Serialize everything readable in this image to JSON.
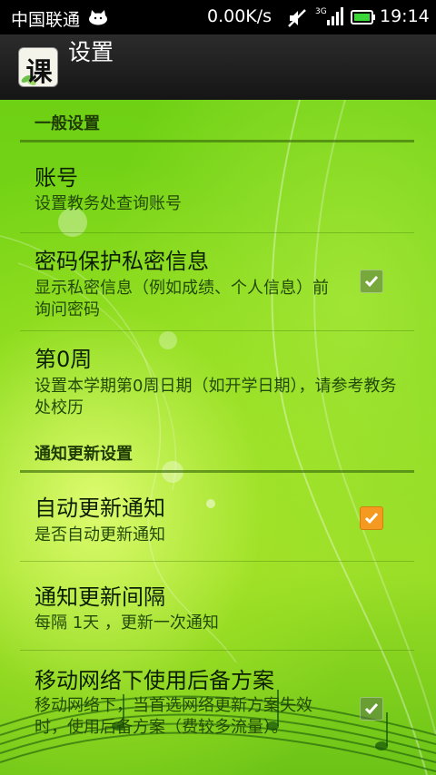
{
  "status_bar": {
    "carrier": "中国联通",
    "speed": "0.00K/s",
    "network_type": "3G",
    "time": "19:14",
    "icons": [
      "cat-icon",
      "mute-icon",
      "signal-icon",
      "battery-icon"
    ]
  },
  "action_bar": {
    "app_icon_char": "课",
    "title": "设置"
  },
  "sections": {
    "general": {
      "title": "一般设置",
      "items": [
        {
          "title": "账号",
          "summary": "设置教务处查询账号"
        },
        {
          "title": "密码保护私密信息",
          "summary": "显示私密信息（例如成绩、个人信息）前询问密码",
          "checked": false
        },
        {
          "title": "第0周",
          "summary": "设置本学期第0周日期（如开学日期），请参考教务处校历"
        }
      ]
    },
    "notify": {
      "title": "通知更新设置",
      "items": [
        {
          "title": "自动更新通知",
          "summary": "是否自动更新通知",
          "checked": true
        },
        {
          "title": "通知更新间隔",
          "summary": "每隔 1天 ，更新一次通知"
        },
        {
          "title": "移动网络下使用后备方案",
          "summary": "移动网络下，当首选网络更新方案失效时，使用后备方案（费较多流量）。",
          "checked": false
        }
      ]
    }
  },
  "colors": {
    "accent_checked": "#f59a20",
    "background_green": "#7ed61a",
    "action_bar": "#1e1e1e"
  }
}
